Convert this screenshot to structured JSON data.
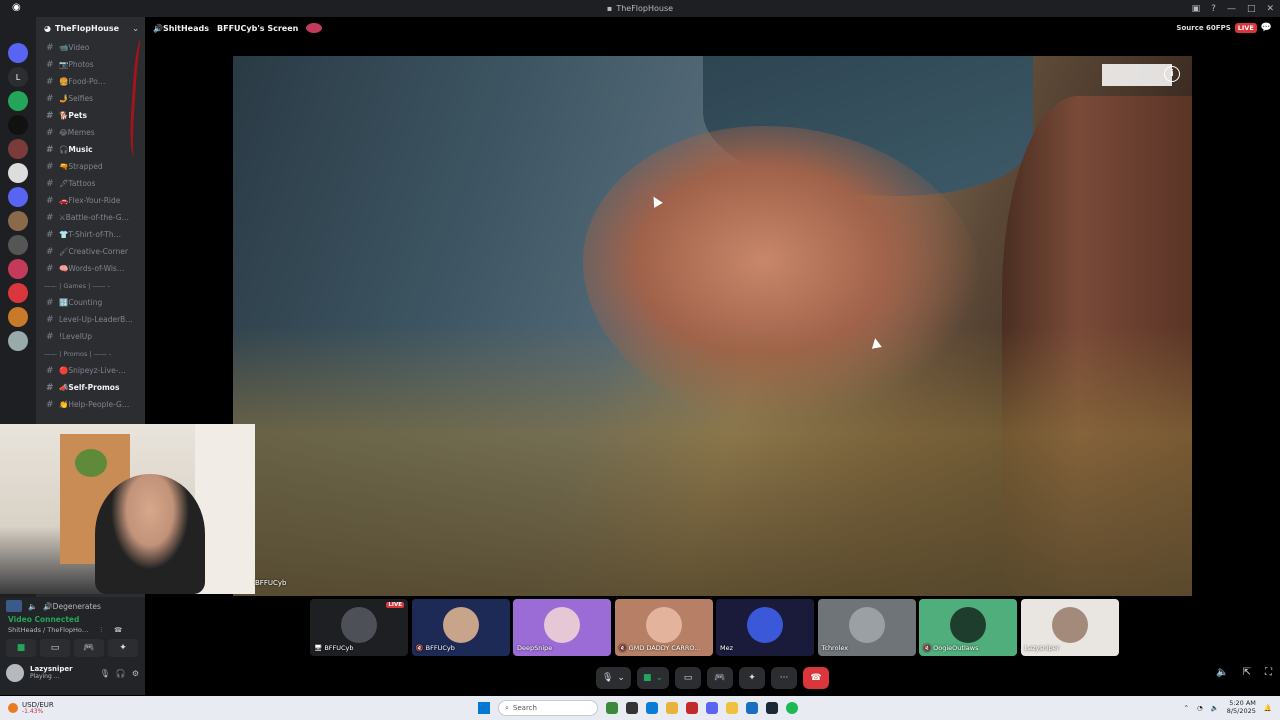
{
  "window": {
    "title": "TheFlopHouse",
    "controls": [
      "—",
      "□",
      "✕"
    ]
  },
  "server": {
    "name": "TheFlopHouse"
  },
  "channels": [
    {
      "label": "📹Video",
      "bold": false
    },
    {
      "label": "📷Photos",
      "bold": false
    },
    {
      "label": "🍔Food-Po…",
      "bold": false
    },
    {
      "label": "🤳Selfies",
      "bold": false
    },
    {
      "label": "🐕Pets",
      "bold": true
    },
    {
      "label": "😂Memes",
      "bold": false
    },
    {
      "label": "🎧Music",
      "bold": true
    },
    {
      "label": "🔫Strapped",
      "bold": false
    },
    {
      "label": "🖋Tattoos",
      "bold": false
    },
    {
      "label": "🚗Flex-Your-Ride",
      "bold": false
    },
    {
      "label": "⚔Battle-of-the-G…",
      "bold": false
    },
    {
      "label": "👕T-Shirt-of-Th…",
      "bold": false
    },
    {
      "label": "🖌Creative-Corner",
      "bold": false
    },
    {
      "label": "🧠Words-of-Wis…",
      "bold": false
    }
  ],
  "category_games": "—— | Games | —— -",
  "channels_games": [
    {
      "label": "🔢Counting",
      "bold": false
    },
    {
      "label": "Level-Up-LeaderB…",
      "bold": false
    },
    {
      "label": "!LevelUp",
      "bold": false
    }
  ],
  "category_promos": "—— | Promos | —— -",
  "channels_promos": [
    {
      "label": "🔴Snipeyz-Live-…",
      "bold": false
    },
    {
      "label": "📣Self-Promos",
      "bold": true
    },
    {
      "label": "👏Help-People-G…",
      "bold": false
    }
  ],
  "voice": {
    "channel": "🔊Degenerates",
    "status": "Video Connected",
    "path": "ShitHeads / TheFlopHo…"
  },
  "user": {
    "name": "Lazysniper",
    "activity": "Playing …"
  },
  "topbar": {
    "channel": "🔊ShitHeads",
    "screen": "BFFUCyb's Screen",
    "source": "Source 60FPS",
    "live": "LIVE"
  },
  "webcam_label": "BFFUCyb",
  "tiles": [
    {
      "name": "🖥 BFFUCyb",
      "live": "LIVE",
      "bg": "#1e1f22",
      "av": "#4e5058"
    },
    {
      "name": "🔇 BFFUCyb",
      "live": "",
      "bg": "#1d2a56",
      "av": "#c8a58a"
    },
    {
      "name": "DeepSnipe",
      "live": "",
      "bg": "#9b6bd6",
      "av": "#e6c7d6"
    },
    {
      "name": "🔇 GMD DADDY CARRO…",
      "live": "",
      "bg": "#b78066",
      "av": "#e3b39c"
    },
    {
      "name": "Mez",
      "live": "",
      "bg": "#1a1b3a",
      "av": "#3b58d8"
    },
    {
      "name": "Tchrolex",
      "live": "",
      "bg": "#6f7478",
      "av": "#9aa0a3"
    },
    {
      "name": "🔇 OogieOutlaws",
      "live": "",
      "bg": "#4fae7c",
      "av": "#1f3d2c"
    },
    {
      "name": "Lazysniper",
      "live": "",
      "bg": "#e9e6e1",
      "av": "#a38a7a"
    }
  ],
  "taskbar": {
    "ticker_name": "USD/EUR",
    "ticker_change": "-1.43%",
    "search": "Search",
    "time": "5:20 AM",
    "date": "8/5/2025"
  },
  "colors": {
    "accent_green": "#23a55a",
    "live_red": "#da373c",
    "sidebar": "#2b2d31"
  }
}
